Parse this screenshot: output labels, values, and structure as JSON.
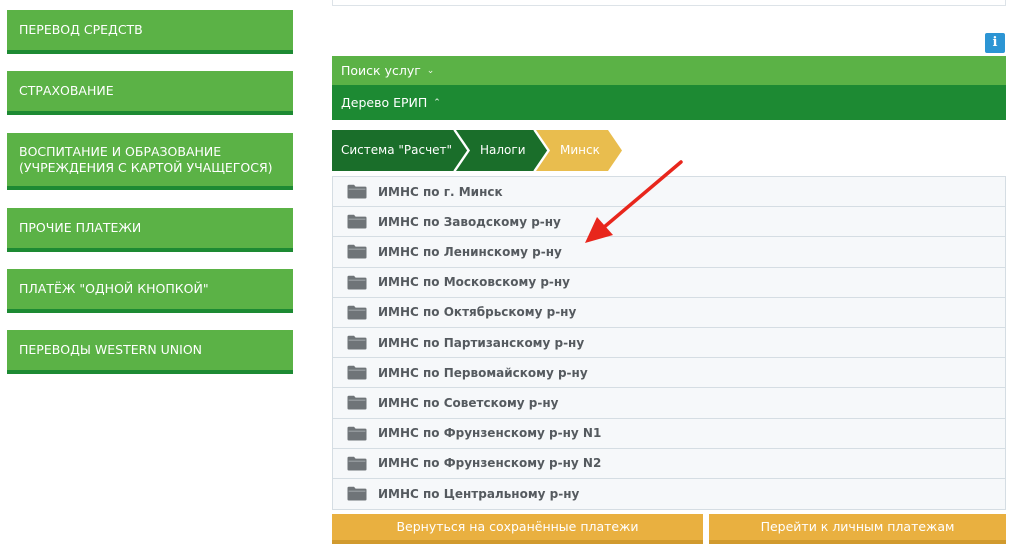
{
  "left_menu": [
    {
      "label": "ПЕРЕВОД СРЕДСТВ"
    },
    {
      "label": "СТРАХОВАНИЕ"
    },
    {
      "label": "ВОСПИТАНИЕ И ОБРАЗОВАНИЕ (УЧРЕЖДЕНИЯ С КАРТОЙ УЧАЩЕГОСЯ)"
    },
    {
      "label": "ПРОЧИЕ ПЛАТЕЖИ"
    },
    {
      "label": "ПЛАТЁЖ \"ОДНОЙ КНОПКОЙ\""
    },
    {
      "label": "ПЕРЕВОДЫ WESTERN UNION"
    }
  ],
  "info_icon": "i",
  "search_bar": {
    "label": "Поиск услуг",
    "chevron": "⌄"
  },
  "tree_bar": {
    "label": "Дерево ЕРИП",
    "chevron": "⌃"
  },
  "breadcrumbs": [
    {
      "label": "Система \"Расчет\""
    },
    {
      "label": "Налоги"
    },
    {
      "label": "Минск"
    }
  ],
  "list_items": [
    {
      "label": "ИМНС по г. Минск"
    },
    {
      "label": "ИМНС по Заводскому р-ну"
    },
    {
      "label": "ИМНС по Ленинскому р-ну"
    },
    {
      "label": "ИМНС по Московскому р-ну"
    },
    {
      "label": "ИМНС по Октябрьскому р-ну"
    },
    {
      "label": "ИМНС по Партизанскому р-ну"
    },
    {
      "label": "ИМНС по Первомайскому р-ну"
    },
    {
      "label": "ИМНС по Советскому р-ну"
    },
    {
      "label": "ИМНС по Фрунзенскому р-ну N1"
    },
    {
      "label": "ИМНС по Фрунзенскому р-ну N2"
    },
    {
      "label": "ИМНС по Центральному р-ну"
    }
  ],
  "bottom_buttons": {
    "saved": "Вернуться на сохранённые платежи",
    "personal": "Перейти к личным платежам"
  },
  "colors": {
    "green": "#5bb246",
    "dark_green": "#1d8a33",
    "crumb_dark": "#1a6e2a",
    "crumb_active": "#e9bd4e",
    "orange": "#e9b040",
    "info_blue": "#2c95d4",
    "arrow_red": "#e8261c"
  },
  "icons": {
    "folder": "folder-icon",
    "info": "info-icon",
    "annotation": "red-arrow-icon"
  }
}
